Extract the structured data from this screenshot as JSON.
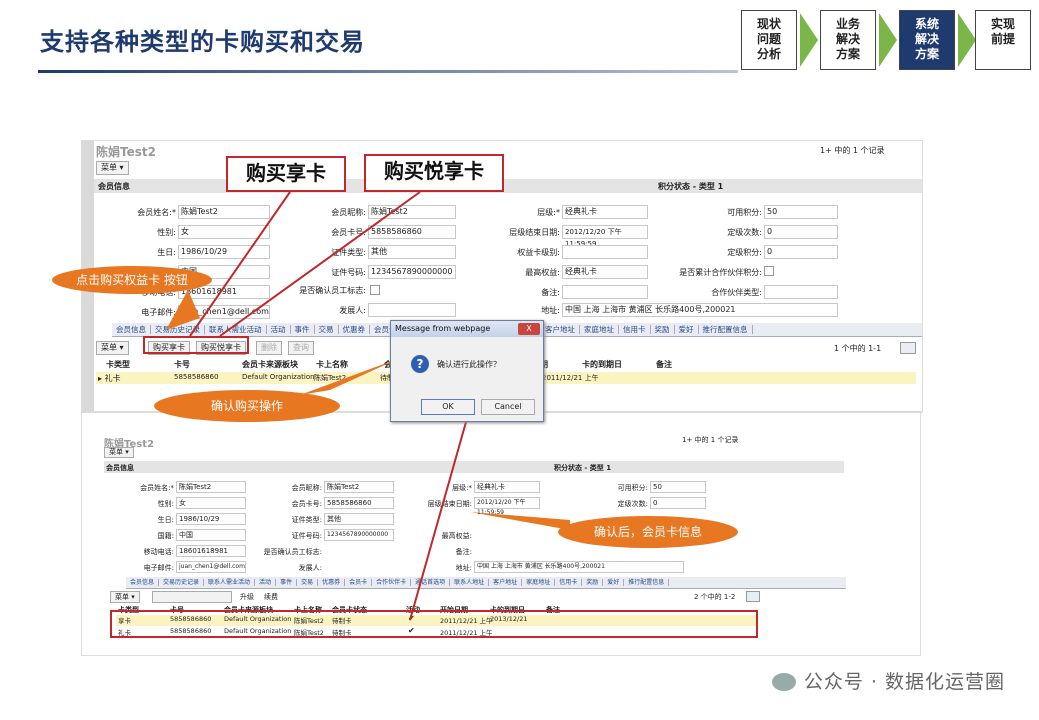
{
  "slide": {
    "title": "支持各种类型的卡购买和交易",
    "steps": [
      "现状\n问题\n分析",
      "业务\n解决\n方案",
      "系统\n解决\n方案",
      "实现\n前提"
    ],
    "active_step": 2,
    "watermark": "公众号 · 数据化运营圈"
  },
  "callouts": {
    "buy_enjoy": "购买享卡",
    "buy_joy": "购买悦享卡",
    "click_btn": "点击购买权益卡 按钮",
    "confirm_buy": "确认购买操作",
    "after_confirm": "确认后，会员卡信息"
  },
  "screen1": {
    "member_name": "陈娟Test2",
    "pager": "1+ 中的  1 个记录",
    "menu": "菜单",
    "section_member": "会员信息",
    "section_points": "积分状态 - 类型 1",
    "fields": {
      "name_label": "会员姓名:*",
      "name_value": "陈娟Test2",
      "gender_label": "性别:",
      "gender_value": "女",
      "birth_label": "生日:",
      "birth_value": "1986/10/29",
      "country_label": "国籍:",
      "country_value": "中国",
      "mobile_label": "移动电话:",
      "mobile_value": "18601618981",
      "email_label": "电子邮件:",
      "email_value": "juan_chen1@dell.com",
      "nick_label": "会员昵称:",
      "nick_value": "陈娟Test2",
      "card_label": "会员卡号:",
      "card_value": "5858586860",
      "idtype_label": "证件类型:",
      "idtype_value": "其他",
      "idno_label": "证件号码:",
      "idno_value": "1234567890000000",
      "staff_label": "是否确认员工标志:",
      "issuer_label": "发展人:",
      "tier_label": "层级:*",
      "tier_value": "经典礼卡",
      "tierend_label": "层级结束日期:",
      "tierend_value": "2012/12/20 下午 11:59:59",
      "benefit_label": "权益卡级别:",
      "maxbenefit_label": "最高权益:",
      "maxbenefit_value": "经典礼卡",
      "remark_label": "备注:",
      "address_label": "地址:",
      "address_value": "中国 上海 上海市 黄浦区 长乐路400号,200021",
      "avail_label": "可用积分:",
      "avail_value": "50",
      "count_label": "定级次数:",
      "count_value": "0",
      "tierpts_label": "定级积分:",
      "tierpts_value": "0",
      "partner_flag_label": "是否累计合作伙伴积分:",
      "partner_type_label": "合作伙伴类型:"
    },
    "tabs": [
      "会员信息",
      "交易历史记录",
      "联系人需业活动",
      "活动",
      "事件",
      "交易",
      "优惠券",
      "会员卡",
      "合作伙伴卡",
      "通话首选项",
      "联系人地址",
      "客户地址",
      "家庭地址",
      "信用卡",
      "奖励",
      "爱好",
      "推行配置信息"
    ],
    "buttons": {
      "menu": "菜单",
      "buy_enjoy": "购买享卡",
      "buy_joy": "购买悦享卡",
      "b3": "删除",
      "b4": "查询"
    },
    "list_pager": "1 个中的  1-1",
    "columns": [
      "卡类型",
      "卡号",
      "会员卡来源板块",
      "卡上名称",
      "会员卡状态",
      "活动",
      "开始日期",
      "卡的到期日",
      "备注"
    ],
    "row": {
      "type": "礼卡",
      "no": "5858586860",
      "src": "Default Organization",
      "name": "陈娟Test2",
      "status": "待制卡",
      "start": "2011/12/21 上午"
    }
  },
  "dialog": {
    "title": "Message from webpage",
    "close": "X",
    "message": "确认进行此操作？",
    "ok": "OK",
    "cancel": "Cancel"
  },
  "screen2": {
    "member_name": "陈娟Test2",
    "pager": "1+ 中的  1 个记录",
    "menu": "菜单",
    "section_member": "会员信息",
    "section_points": "积分状态 - 类型 1",
    "list_pager": "2 个中的  1-2",
    "buttons": {
      "b1": "升级",
      "b2": "续费"
    },
    "columns": [
      "卡类型",
      "卡号",
      "会员卡来源板块",
      "卡上名称",
      "会员卡状态",
      "活动",
      "开始日期",
      "卡的到期日",
      "备注"
    ],
    "rows": [
      {
        "type": "享卡",
        "no": "5858586860",
        "src": "Default Organization",
        "name": "陈娟Test2",
        "status": "待制卡",
        "active": "✔",
        "start": "2011/12/21 上午",
        "end": "2013/12/21"
      },
      {
        "type": "礼卡",
        "no": "5858586860",
        "src": "Default Organization",
        "name": "陈娟Test2",
        "status": "待制卡",
        "active": "✔",
        "start": "2011/12/21 上午",
        "end": ""
      }
    ]
  }
}
